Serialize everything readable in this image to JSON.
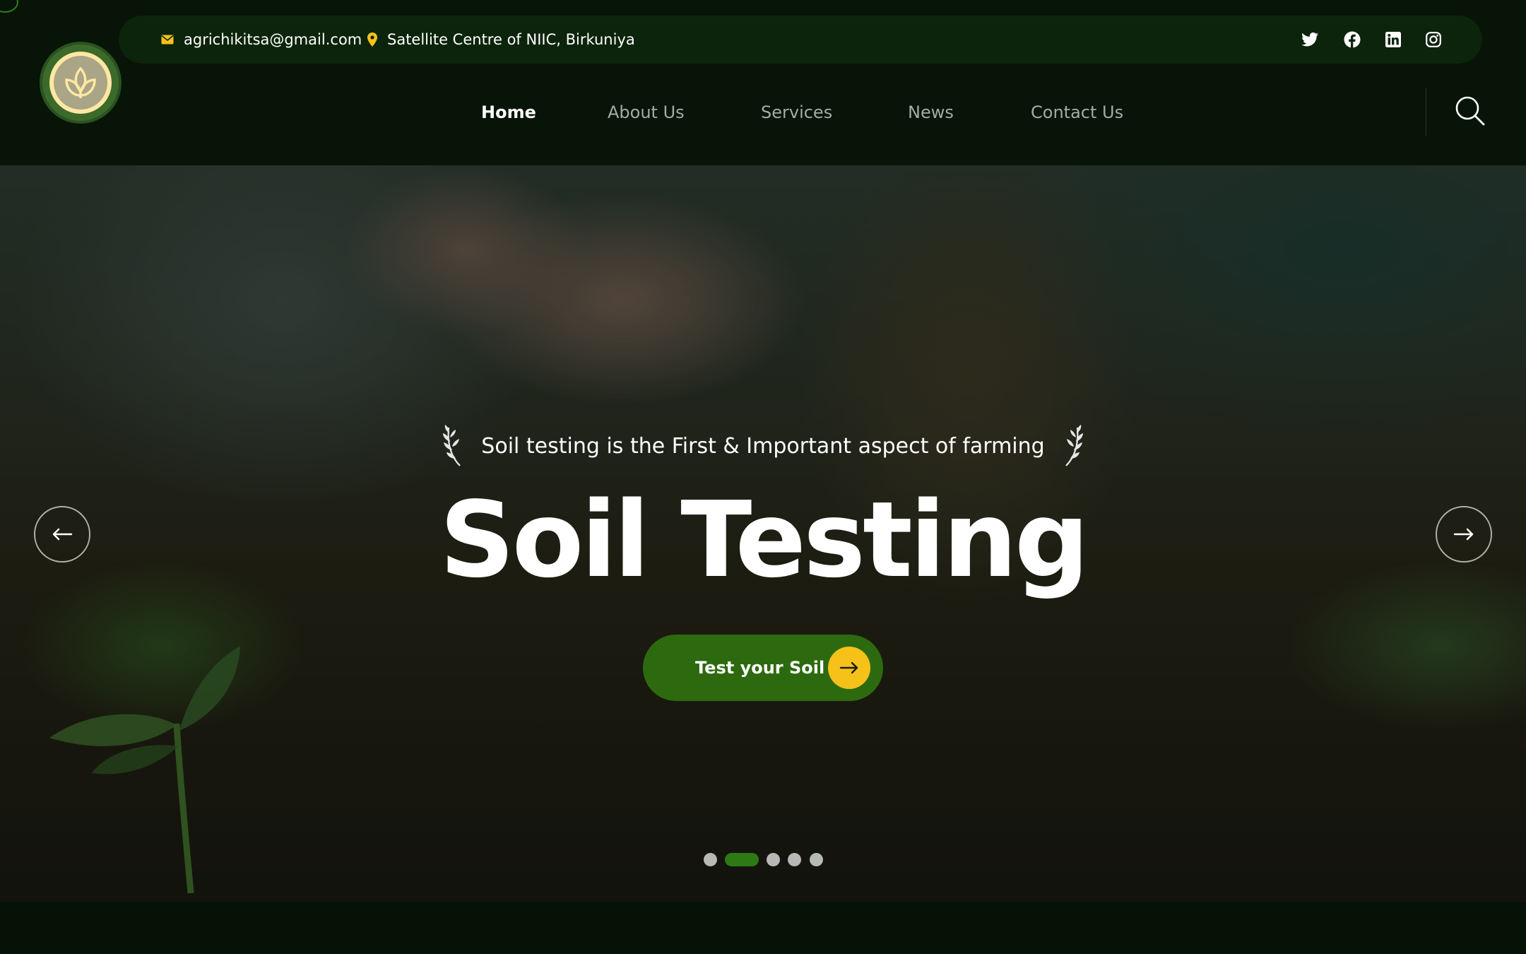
{
  "topbar": {
    "email": "agrichikitsa@gmail.com",
    "address": "Satellite Centre of NIIC, Birkuniya",
    "socials": [
      "twitter-icon",
      "facebook-icon",
      "linkedin-icon",
      "instagram-icon"
    ]
  },
  "nav": {
    "items": [
      "Home",
      "About Us",
      "Services",
      "News",
      "Contact Us"
    ],
    "active": "Home"
  },
  "hero": {
    "tagline": "Soil testing is the First & Important aspect of farming",
    "title": "Soil Testing",
    "cta_label": "Test your Soil",
    "slide_count": 5,
    "active_slide": 2
  },
  "colors": {
    "accent_green": "#2d6a0f",
    "accent_yellow": "#f6c21a",
    "header_bg": "#071407",
    "topbar_bg": "#0c240b"
  }
}
